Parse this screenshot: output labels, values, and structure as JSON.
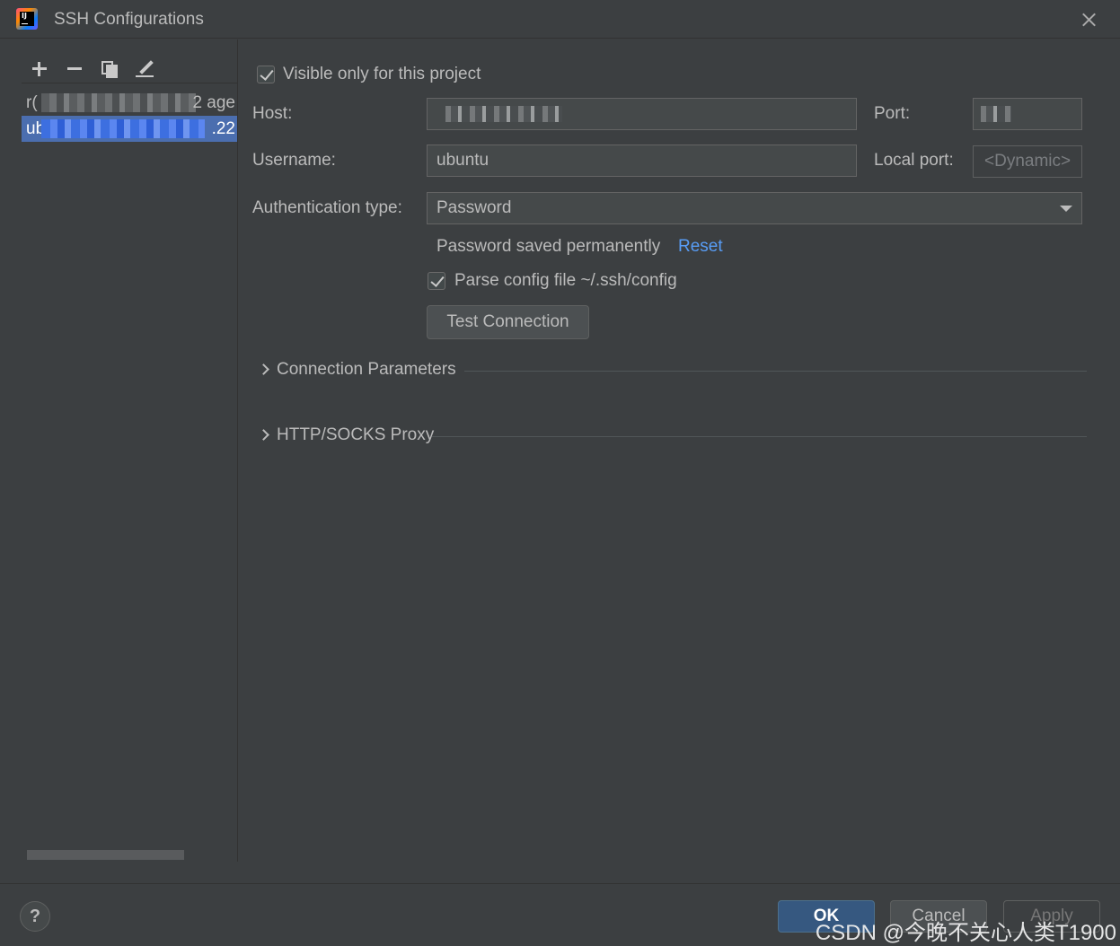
{
  "window": {
    "title": "SSH Configurations"
  },
  "configs": [
    {
      "prefix": "r(",
      "suffix": "2 age",
      "selected": false
    },
    {
      "prefix": "ub",
      "suffix": ".22",
      "selected": true
    }
  ],
  "form": {
    "visible_only_label": "Visible only for this project",
    "visible_only_checked": true,
    "host_label": "Host:",
    "port_label": "Port:",
    "username_label": "Username:",
    "username_value": "ubuntu",
    "local_port_label": "Local port:",
    "local_port_placeholder": "<Dynamic>",
    "auth_type_label": "Authentication type:",
    "auth_type_value": "Password",
    "password_note": "Password saved permanently",
    "reset_link": "Reset",
    "parse_config_label": "Parse config file ~/.ssh/config",
    "parse_config_checked": true,
    "test_connection_label": "Test Connection"
  },
  "sections": {
    "connection_parameters": "Connection Parameters",
    "proxy": "HTTP/SOCKS Proxy"
  },
  "footer": {
    "help": "?",
    "ok": "OK",
    "cancel": "Cancel",
    "apply": "Apply"
  },
  "watermark": "CSDN @今晚不关心人类T1900",
  "colors": {
    "background": "#3c3f41",
    "selection": "#4b6eaf",
    "link": "#589df6",
    "ok_button": "#365880"
  }
}
